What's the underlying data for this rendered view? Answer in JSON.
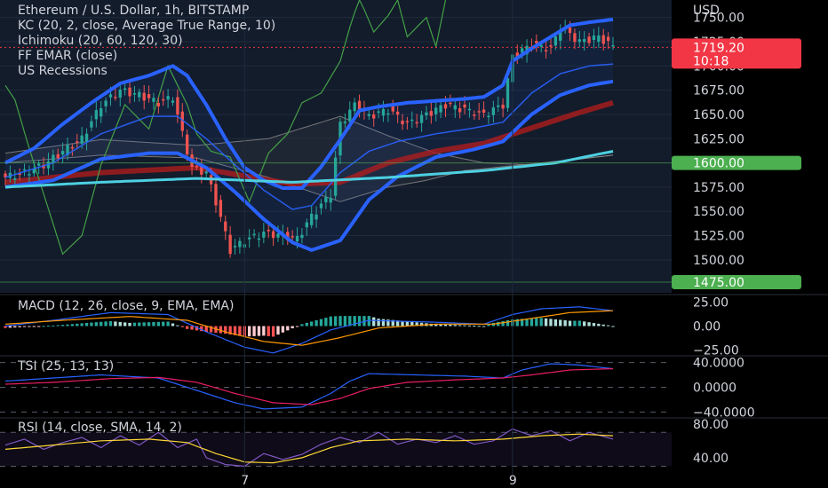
{
  "window": {
    "currency": "USD"
  },
  "legend": {
    "symbol": "Ethereum / U.S. Dollar, 1h, BITSTAMP",
    "kc": "KC (20, 2, close, Average True Range, 10)",
    "ichimoku": "Ichimoku (20, 60, 120, 30)",
    "emar": "FF EMAR (close)",
    "recessions": "US Recessions"
  },
  "colors": {
    "background": "#000000",
    "price_pane_bg": "#131c2b",
    "up": "#26a69a",
    "down": "#ef5350",
    "kc_band": "#2962ff",
    "ema_cyan": "#4dd0e1",
    "ema_red": "#b71c1c",
    "ichimoku_lagging": "#43a047",
    "ichimoku_cloud": "#8d8d8d",
    "badge_red": "#f23645",
    "badge_green": "#4caf50",
    "macd": "#2962ff",
    "signal": "#ff9800",
    "tsi": "#2962ff",
    "tsi_signal": "#e91e63",
    "rsi": "#7e57c2",
    "rsi_ma": "#fdd835"
  },
  "price_badges": {
    "last_price": "1719.20",
    "countdown": "10:18",
    "level_high": "1600.00",
    "level_low": "1475.00"
  },
  "chart_data": [
    {
      "type": "line",
      "pane": "price",
      "title": "Ethereum / U.S. Dollar, 1h, BITSTAMP",
      "ylim": [
        1466,
        1768
      ],
      "yticks": [
        1500,
        1525,
        1550,
        1575,
        1600,
        1625,
        1650,
        1675,
        1700,
        1725,
        1750
      ],
      "ytick_labels": [
        "1500.00",
        "1525.00",
        "1550.00",
        "1575.00",
        "1600.00",
        "1625.00",
        "1650.00",
        "1675.00",
        "1700.00",
        "1725.00",
        "1750.00"
      ],
      "x_ticks": [
        {
          "label": "7",
          "index": 50
        },
        {
          "label": "9",
          "index": 106
        }
      ],
      "x_count": 128,
      "anchors": {
        "close": [
          [
            0,
            1585
          ],
          [
            4,
            1590
          ],
          [
            8,
            1598
          ],
          [
            12,
            1612
          ],
          [
            16,
            1625
          ],
          [
            20,
            1660
          ],
          [
            24,
            1675
          ],
          [
            28,
            1670
          ],
          [
            32,
            1662
          ],
          [
            35,
            1668
          ],
          [
            37,
            1630
          ],
          [
            39,
            1595
          ],
          [
            42,
            1590
          ],
          [
            44,
            1560
          ],
          [
            47,
            1510
          ],
          [
            50,
            1520
          ],
          [
            54,
            1528
          ],
          [
            58,
            1525
          ],
          [
            61,
            1522
          ],
          [
            64,
            1545
          ],
          [
            68,
            1568
          ],
          [
            70,
            1640
          ],
          [
            73,
            1660
          ],
          [
            76,
            1648
          ],
          [
            80,
            1655
          ],
          [
            84,
            1640
          ],
          [
            88,
            1650
          ],
          [
            92,
            1660
          ],
          [
            96,
            1655
          ],
          [
            100,
            1650
          ],
          [
            104,
            1660
          ],
          [
            106,
            1710
          ],
          [
            110,
            1722
          ],
          [
            114,
            1718
          ],
          [
            116,
            1740
          ],
          [
            120,
            1725
          ],
          [
            124,
            1730
          ],
          [
            127,
            1720
          ]
        ],
        "kc_upper": [
          [
            0,
            1600
          ],
          [
            6,
            1615
          ],
          [
            12,
            1640
          ],
          [
            18,
            1662
          ],
          [
            24,
            1682
          ],
          [
            30,
            1690
          ],
          [
            35,
            1700
          ],
          [
            38,
            1690
          ],
          [
            42,
            1660
          ],
          [
            46,
            1625
          ],
          [
            50,
            1595
          ],
          [
            54,
            1582
          ],
          [
            58,
            1574
          ],
          [
            62,
            1574
          ],
          [
            66,
            1596
          ],
          [
            70,
            1624
          ],
          [
            74,
            1654
          ],
          [
            78,
            1658
          ],
          [
            84,
            1662
          ],
          [
            90,
            1664
          ],
          [
            96,
            1666
          ],
          [
            100,
            1668
          ],
          [
            104,
            1680
          ],
          [
            106,
            1705
          ],
          [
            110,
            1718
          ],
          [
            114,
            1730
          ],
          [
            118,
            1742
          ],
          [
            122,
            1745
          ],
          [
            127,
            1748
          ]
        ],
        "kc_mid": [
          [
            0,
            1585
          ],
          [
            10,
            1600
          ],
          [
            20,
            1630
          ],
          [
            30,
            1648
          ],
          [
            36,
            1648
          ],
          [
            42,
            1625
          ],
          [
            48,
            1598
          ],
          [
            54,
            1572
          ],
          [
            60,
            1552
          ],
          [
            64,
            1556
          ],
          [
            70,
            1590
          ],
          [
            76,
            1612
          ],
          [
            82,
            1622
          ],
          [
            90,
            1630
          ],
          [
            98,
            1636
          ],
          [
            104,
            1642
          ],
          [
            110,
            1672
          ],
          [
            116,
            1692
          ],
          [
            122,
            1700
          ],
          [
            127,
            1702
          ]
        ],
        "kc_lower": [
          [
            0,
            1575
          ],
          [
            10,
            1582
          ],
          [
            20,
            1604
          ],
          [
            30,
            1610
          ],
          [
            36,
            1610
          ],
          [
            42,
            1595
          ],
          [
            48,
            1570
          ],
          [
            54,
            1542
          ],
          [
            60,
            1518
          ],
          [
            64,
            1510
          ],
          [
            70,
            1520
          ],
          [
            76,
            1562
          ],
          [
            82,
            1586
          ],
          [
            90,
            1606
          ],
          [
            98,
            1614
          ],
          [
            104,
            1622
          ],
          [
            110,
            1650
          ],
          [
            116,
            1670
          ],
          [
            122,
            1680
          ],
          [
            127,
            1684
          ]
        ],
        "ema_cyan": [
          [
            0,
            1575
          ],
          [
            20,
            1580
          ],
          [
            40,
            1584
          ],
          [
            60,
            1580
          ],
          [
            80,
            1585
          ],
          [
            100,
            1592
          ],
          [
            115,
            1600
          ],
          [
            127,
            1612
          ]
        ],
        "ema_red": [
          [
            0,
            1580
          ],
          [
            20,
            1590
          ],
          [
            40,
            1595
          ],
          [
            60,
            1578
          ],
          [
            70,
            1580
          ],
          [
            80,
            1600
          ],
          [
            90,
            1612
          ],
          [
            100,
            1620
          ],
          [
            110,
            1636
          ],
          [
            120,
            1652
          ],
          [
            127,
            1662
          ]
        ],
        "lagging": [
          [
            0,
            1680
          ],
          [
            2,
            1665
          ],
          [
            5,
            1615
          ],
          [
            8,
            1568
          ],
          [
            12,
            1506
          ],
          [
            16,
            1525
          ],
          [
            20,
            1598
          ],
          [
            25,
            1660
          ],
          [
            30,
            1635
          ],
          [
            34,
            1700
          ],
          [
            38,
            1660
          ],
          [
            40,
            1630
          ],
          [
            43,
            1612
          ],
          [
            47,
            1606
          ],
          [
            51,
            1560
          ],
          [
            55,
            1610
          ],
          [
            59,
            1630
          ],
          [
            62,
            1662
          ],
          [
            66,
            1672
          ],
          [
            70,
            1705
          ],
          [
            72,
            1740
          ],
          [
            74,
            1770
          ],
          [
            77,
            1735
          ],
          [
            80,
            1752
          ],
          [
            82,
            1768
          ],
          [
            84,
            1730
          ],
          [
            86,
            1740
          ],
          [
            88,
            1750
          ],
          [
            90,
            1720
          ],
          [
            92,
            1768
          ]
        ],
        "cloud_a": [
          [
            0,
            1610
          ],
          [
            20,
            1624
          ],
          [
            40,
            1618
          ],
          [
            55,
            1625
          ],
          [
            70,
            1648
          ],
          [
            80,
            1628
          ],
          [
            90,
            1610
          ],
          [
            100,
            1600
          ],
          [
            110,
            1598
          ],
          [
            120,
            1604
          ],
          [
            127,
            1608
          ]
        ],
        "cloud_b": [
          [
            0,
            1600
          ],
          [
            20,
            1608
          ],
          [
            40,
            1605
          ],
          [
            55,
            1585
          ],
          [
            70,
            1560
          ],
          [
            80,
            1575
          ],
          [
            88,
            1582
          ],
          [
            96,
            1592
          ],
          [
            104,
            1596
          ],
          [
            112,
            1600
          ],
          [
            120,
            1604
          ],
          [
            127,
            1608
          ]
        ]
      }
    },
    {
      "type": "bar",
      "pane": "macd",
      "title": "MACD (12, 26, close, 9, EMA, EMA)",
      "ylim": [
        -30,
        30
      ],
      "yticks": [
        25,
        0,
        -25
      ],
      "ytick_labels": [
        "25.00",
        "0.00",
        "−25.00"
      ],
      "anchors": {
        "macd": [
          [
            0,
            0
          ],
          [
            10,
            6
          ],
          [
            22,
            14
          ],
          [
            34,
            12
          ],
          [
            42,
            -6
          ],
          [
            50,
            -22
          ],
          [
            56,
            -28
          ],
          [
            62,
            -18
          ],
          [
            68,
            -4
          ],
          [
            76,
            6
          ],
          [
            90,
            4
          ],
          [
            100,
            2
          ],
          [
            106,
            12
          ],
          [
            112,
            18
          ],
          [
            120,
            20
          ],
          [
            127,
            16
          ]
        ],
        "signal": [
          [
            0,
            2
          ],
          [
            12,
            6
          ],
          [
            26,
            10
          ],
          [
            38,
            6
          ],
          [
            46,
            -6
          ],
          [
            54,
            -16
          ],
          [
            62,
            -20
          ],
          [
            70,
            -12
          ],
          [
            78,
            -2
          ],
          [
            90,
            2
          ],
          [
            102,
            2
          ],
          [
            110,
            8
          ],
          [
            118,
            14
          ],
          [
            127,
            16
          ]
        ]
      }
    },
    {
      "type": "line",
      "pane": "tsi",
      "title": "TSI (25, 13, 13)",
      "ylim": [
        -48,
        48
      ],
      "yticks": [
        40,
        0,
        -40
      ],
      "ytick_labels": [
        "40.0000",
        "0.0000",
        "−40.0000"
      ],
      "anchors": {
        "tsi": [
          [
            0,
            10
          ],
          [
            10,
            15
          ],
          [
            20,
            20
          ],
          [
            32,
            15
          ],
          [
            40,
            -5
          ],
          [
            48,
            -25
          ],
          [
            54,
            -35
          ],
          [
            62,
            -32
          ],
          [
            68,
            -10
          ],
          [
            72,
            10
          ],
          [
            76,
            22
          ],
          [
            86,
            20
          ],
          [
            96,
            18
          ],
          [
            104,
            15
          ],
          [
            108,
            28
          ],
          [
            114,
            38
          ],
          [
            120,
            36
          ],
          [
            127,
            30
          ]
        ],
        "signal": [
          [
            0,
            5
          ],
          [
            10,
            8
          ],
          [
            22,
            14
          ],
          [
            32,
            16
          ],
          [
            40,
            8
          ],
          [
            48,
            -10
          ],
          [
            56,
            -25
          ],
          [
            64,
            -28
          ],
          [
            70,
            -18
          ],
          [
            76,
            -2
          ],
          [
            84,
            8
          ],
          [
            94,
            12
          ],
          [
            104,
            15
          ],
          [
            110,
            20
          ],
          [
            118,
            28
          ],
          [
            127,
            30
          ]
        ]
      }
    },
    {
      "type": "line",
      "pane": "rsi",
      "title": "RSI (14, close, SMA, 14, 2)",
      "ylim": [
        20,
        85
      ],
      "yticks": [
        80,
        40
      ],
      "ytick_labels": [
        "80.00",
        "40.00"
      ],
      "band": [
        30,
        70
      ],
      "anchors": {
        "rsi": [
          [
            0,
            55
          ],
          [
            4,
            62
          ],
          [
            8,
            50
          ],
          [
            12,
            58
          ],
          [
            16,
            64
          ],
          [
            20,
            52
          ],
          [
            24,
            66
          ],
          [
            28,
            55
          ],
          [
            32,
            70
          ],
          [
            36,
            52
          ],
          [
            40,
            62
          ],
          [
            42,
            40
          ],
          [
            46,
            32
          ],
          [
            50,
            30
          ],
          [
            54,
            45
          ],
          [
            58,
            38
          ],
          [
            62,
            44
          ],
          [
            66,
            56
          ],
          [
            70,
            64
          ],
          [
            74,
            58
          ],
          [
            78,
            70
          ],
          [
            82,
            56
          ],
          [
            86,
            62
          ],
          [
            90,
            58
          ],
          [
            94,
            66
          ],
          [
            98,
            56
          ],
          [
            102,
            60
          ],
          [
            106,
            74
          ],
          [
            110,
            66
          ],
          [
            114,
            72
          ],
          [
            118,
            60
          ],
          [
            122,
            70
          ],
          [
            127,
            62
          ]
        ],
        "ma": [
          [
            0,
            50
          ],
          [
            10,
            55
          ],
          [
            20,
            60
          ],
          [
            30,
            62
          ],
          [
            38,
            58
          ],
          [
            44,
            45
          ],
          [
            50,
            35
          ],
          [
            56,
            34
          ],
          [
            62,
            40
          ],
          [
            68,
            52
          ],
          [
            74,
            60
          ],
          [
            84,
            62
          ],
          [
            94,
            60
          ],
          [
            104,
            62
          ],
          [
            112,
            66
          ],
          [
            120,
            68
          ],
          [
            127,
            66
          ]
        ]
      }
    }
  ]
}
